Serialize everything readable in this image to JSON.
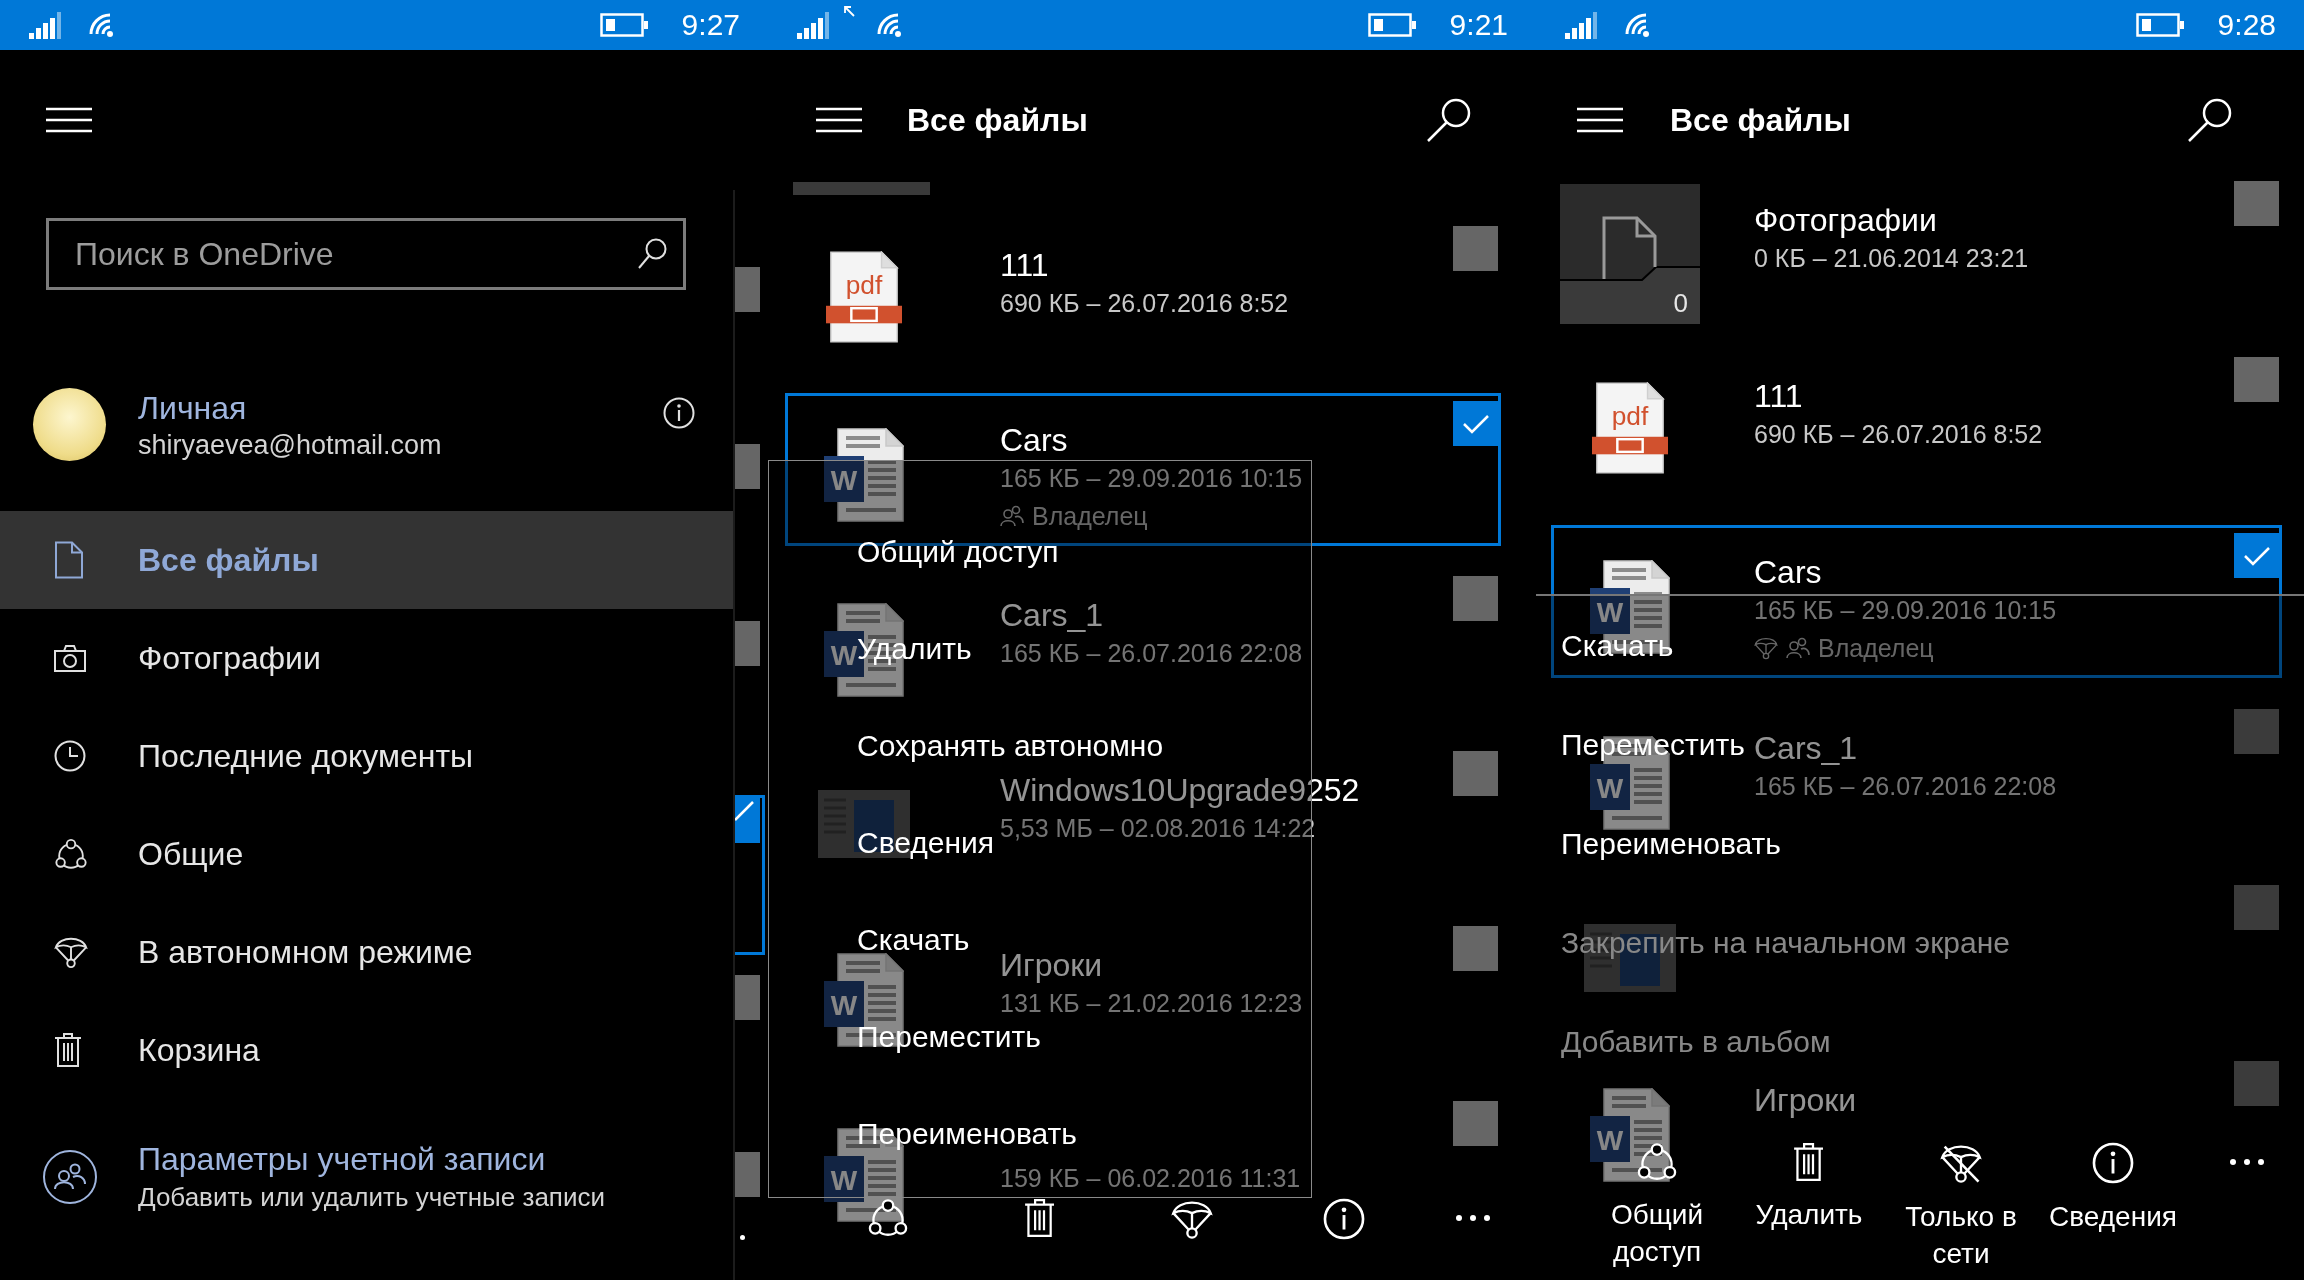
{
  "drawer_screen": {
    "status_bar": {
      "time": "9:27"
    },
    "search": {
      "placeholder": "Поиск в OneDrive"
    },
    "account": {
      "name": "Личная",
      "email": "shiryaevea@hotmail.com"
    },
    "nav_items": [
      {
        "kind": "files",
        "label": "Все файлы",
        "selected": true
      },
      {
        "kind": "photos",
        "label": "Фотографии",
        "selected": false
      },
      {
        "kind": "recent",
        "label": "Последние документы",
        "selected": false
      },
      {
        "kind": "shared",
        "label": "Общие",
        "selected": false
      },
      {
        "kind": "offline",
        "label": "В автономном режиме",
        "selected": false
      },
      {
        "kind": "recycle",
        "label": "Корзина",
        "selected": false
      }
    ],
    "account_settings": {
      "title": "Параметры учетной записи",
      "subtitle": "Добавить или удалить учетные записи"
    },
    "list_edge": [
      {
        "selected": false
      },
      {
        "selected": false
      },
      {
        "selected": false
      },
      {
        "selected": true
      },
      {
        "selected": false
      },
      {
        "selected": false
      }
    ]
  },
  "context_menu_screen": {
    "status_bar": {
      "time": "9:21",
      "data_activity": true
    },
    "title": "Все файлы",
    "files": [
      {
        "kind": "pdf",
        "type_label": "pdf",
        "name": "111",
        "details": "690 КБ – 26.07.2016 8:52",
        "selected": false
      },
      {
        "kind": "document",
        "type_label": "W",
        "name": "Cars",
        "details": "165 КБ – 29.09.2016 10:15",
        "owner": "Владелец",
        "selected": true
      },
      {
        "kind": "document",
        "type_label": "W",
        "name": "Cars_1",
        "details": "165 КБ – 26.07.2016 22:08",
        "selected": false
      },
      {
        "kind": "thumbnail",
        "name": "Windows10Upgrade9252",
        "details": "5,53 МБ – 02.08.2016 14:22",
        "selected": false
      },
      {
        "kind": "document",
        "type_label": "W",
        "name": "Игроки",
        "details": "131 КБ – 21.02.2016 12:23",
        "selected": false
      },
      {
        "kind": "document",
        "type_label": "W",
        "details": "159 КБ – 06.02.2016 11:31",
        "selected": false
      }
    ],
    "menu": [
      {
        "label": "Общий доступ"
      },
      {
        "label": "Удалить"
      },
      {
        "label": "Сохранять автономно"
      },
      {
        "label": "Сведения"
      },
      {
        "label": "Скачать"
      },
      {
        "label": "Переместить"
      },
      {
        "label": "Переименовать"
      }
    ],
    "app_bar": [
      {
        "kind": "share"
      },
      {
        "kind": "delete"
      },
      {
        "kind": "offline"
      },
      {
        "kind": "info"
      },
      {
        "kind": "more"
      }
    ]
  },
  "app_bar_screen": {
    "status_bar": {
      "time": "9:28"
    },
    "title": "Все файлы",
    "files": [
      {
        "kind": "folder",
        "count": "0",
        "name": "Фотографии",
        "details": "0 КБ – 21.06.2014 23:21",
        "selected": false
      },
      {
        "kind": "pdf",
        "type_label": "pdf",
        "name": "111",
        "details": "690 КБ – 26.07.2016 8:52",
        "selected": false
      },
      {
        "kind": "document",
        "type_label": "W",
        "name": "Cars",
        "details": "165 КБ – 29.09.2016 10:15",
        "owner": "Владелец",
        "offline": true,
        "selected": true
      },
      {
        "kind": "document",
        "type_label": "W",
        "name": "Cars_1",
        "details": "165 КБ – 26.07.2016 22:08",
        "selected": false
      },
      {
        "kind": "thumbnail",
        "selected": false
      },
      {
        "kind": "document",
        "type_label": "W",
        "name": "Игроки",
        "selected": false
      }
    ],
    "menu": [
      {
        "label": "Скачать",
        "disabled": false
      },
      {
        "label": "Переместить",
        "disabled": false
      },
      {
        "label": "Переименовать",
        "disabled": false
      },
      {
        "label": "Закрепить на начальном экране",
        "disabled": true
      },
      {
        "label": "Добавить в альбом",
        "disabled": true
      }
    ],
    "app_bar": [
      {
        "kind": "share",
        "label": "Общий доступ"
      },
      {
        "kind": "delete",
        "label": "Удалить"
      },
      {
        "kind": "online_only",
        "label": "Только в сети"
      },
      {
        "kind": "info",
        "label": "Сведения"
      },
      {
        "kind": "more"
      }
    ]
  }
}
